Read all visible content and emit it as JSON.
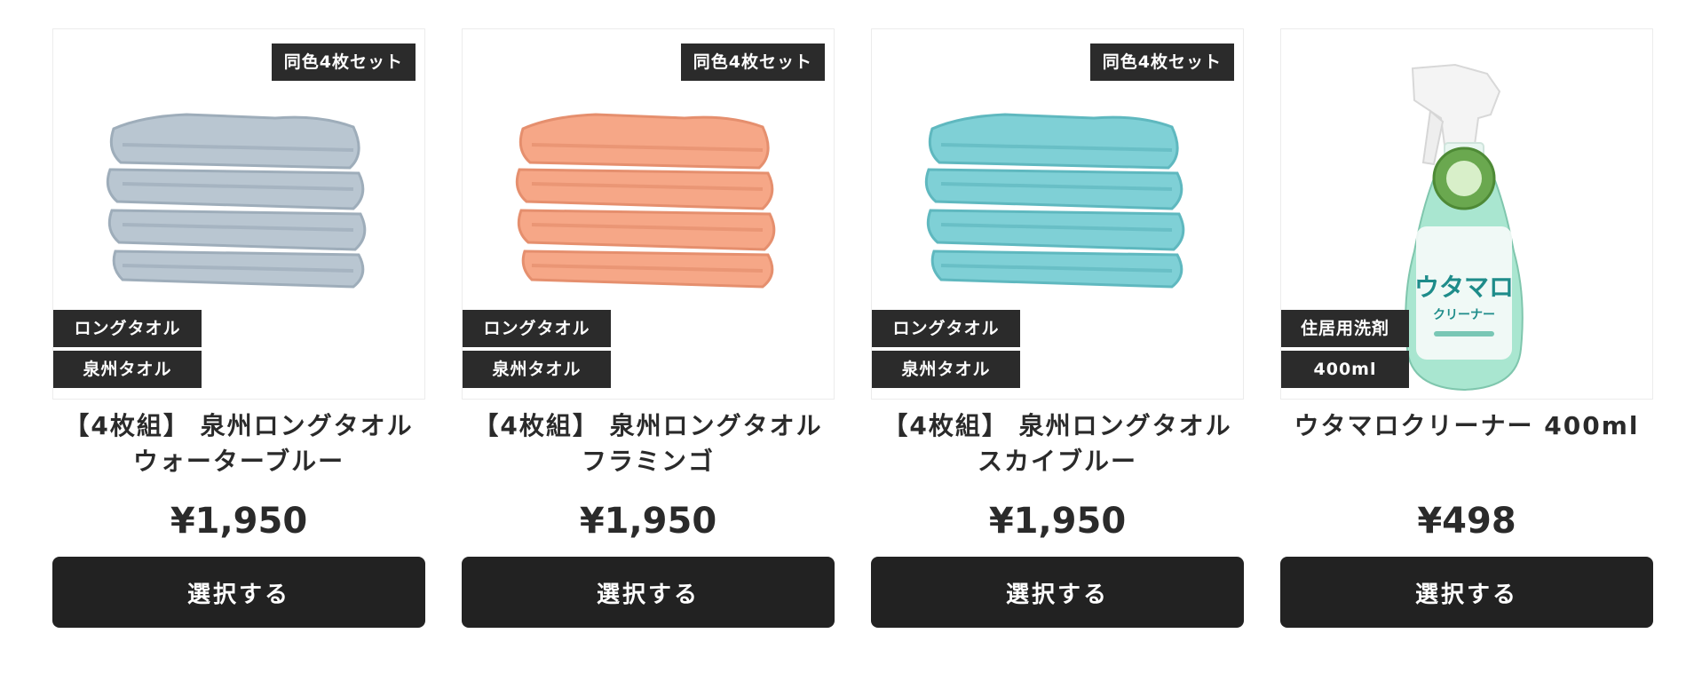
{
  "products": [
    {
      "title_line1": "【4枚組】 泉州ロングタオル",
      "title_line2": "ウォーターブルー",
      "price": "¥1,950",
      "badge_top": "同色4枚セット",
      "badge_bottom_1": "ロングタオル",
      "badge_bottom_2": "泉州タオル",
      "button_label": "選択する",
      "towel_color": "#b9c6d1",
      "towel_shade": "#9eadba"
    },
    {
      "title_line1": "【4枚組】 泉州ロングタオル",
      "title_line2": "フラミンゴ",
      "price": "¥1,950",
      "badge_top": "同色4枚セット",
      "badge_bottom_1": "ロングタオル",
      "badge_bottom_2": "泉州タオル",
      "button_label": "選択する",
      "towel_color": "#f6a787",
      "towel_shade": "#e58f6e"
    },
    {
      "title_line1": "【4枚組】 泉州ロングタオル",
      "title_line2": "スカイブルー",
      "price": "¥1,950",
      "badge_top": "同色4枚セット",
      "badge_bottom_1": "ロングタオル",
      "badge_bottom_2": "泉州タオル",
      "button_label": "選択する",
      "towel_color": "#7fd0d6",
      "towel_shade": "#5fb8bf"
    },
    {
      "title_line1": "ウタマロクリーナー 400ml",
      "title_line2": "",
      "price": "¥498",
      "badge_bottom_1": "住居用洗剤",
      "badge_bottom_2": "400ml",
      "button_label": "選択する",
      "bottle_label_brand": "ウタマロ",
      "bottle_label_sub": "クリーナー",
      "bottle_color": "#a9e6d0"
    }
  ]
}
